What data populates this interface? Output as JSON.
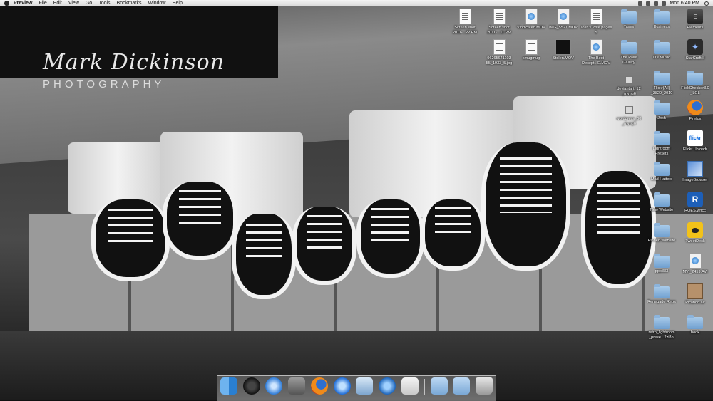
{
  "menubar": {
    "app_name": "Preview",
    "items": [
      "File",
      "Edit",
      "View",
      "Go",
      "Tools",
      "Bookmarks",
      "Window",
      "Help"
    ],
    "clock": "Mon 6:40 PM"
  },
  "wallpaper": {
    "watermark_name": "Mark Dickinson",
    "watermark_sub": "PHOTOGRAPHY"
  },
  "desktop_icons": [
    {
      "label": "Screen shot\n2011-...22 PM",
      "icon": "document-icon"
    },
    {
      "label": "Screen shot\n2011-...11 PM",
      "icon": "document-icon"
    },
    {
      "label": "Vindicated.MOV",
      "icon": "movie-icon"
    },
    {
      "label": "IMG_5527.MOV",
      "icon": "movie-icon"
    },
    {
      "label": "Josh's Wife.pages\n5",
      "icon": "document-icon"
    },
    {
      "label": "Taxes",
      "icon": "folder-icon"
    },
    {
      "label": "Business",
      "icon": "folder-icon"
    },
    {
      "label": "Elements",
      "icon": "elements-icon"
    },
    {
      "label": "96265641103\n55_1933_5.jpg",
      "icon": "document-icon"
    },
    {
      "label": "smugmug",
      "icon": "document-icon"
    },
    {
      "label": "Stolen.MOV",
      "icon": "dark-icon"
    },
    {
      "label": "The Best\nDecept...E.MOV",
      "icon": "movie-icon"
    },
    {
      "label": "The Paint\nGallery",
      "icon": "folder-icon"
    },
    {
      "label": "D's Music",
      "icon": "folder-icon"
    },
    {
      "label": "StarCraft II",
      "icon": "starcraft-icon"
    },
    {
      "label": "deviantart_12\n_myng6",
      "icon": "small-file-icon"
    },
    {
      "label": "Flickr(All)\n_3829_2010",
      "icon": "folder-icon"
    },
    {
      "label": "FlickChecker3.0\n_LGL",
      "icon": "folder-icon"
    },
    {
      "label": "wordpress_60\n_myng6",
      "icon": "small-file-icon"
    },
    {
      "label": "Josh",
      "icon": "folder-icon"
    },
    {
      "label": "Firefox",
      "icon": "firefox-icon"
    },
    {
      "label": "Lightroom\nPresets",
      "icon": "folder-icon"
    },
    {
      "label": "Flickr Uploadr",
      "icon": "flickr-icon"
    },
    {
      "label": "Mad Hatters",
      "icon": "folder-icon"
    },
    {
      "label": "ImageBrowser",
      "icon": "image-browser-icon"
    },
    {
      "label": "New Website",
      "icon": "folder-icon"
    },
    {
      "label": "ROES.whcc",
      "icon": "roes-icon"
    },
    {
      "label": "Pinned Website",
      "icon": "folder-icon"
    },
    {
      "label": "TweetDeck",
      "icon": "tweetdeck-icon"
    },
    {
      "label": "ppp883",
      "icon": "folder-icon"
    },
    {
      "label": "MVI_2459.AVI",
      "icon": "movie-icon"
    },
    {
      "label": "Renegade Reps",
      "icon": "folder-icon"
    },
    {
      "label": "Picaboo.air",
      "icon": "package-icon"
    },
    {
      "label": "retro_lightroom\n_prese...2zi3hi",
      "icon": "folder-icon"
    },
    {
      "label": "book",
      "icon": "folder-icon"
    }
  ],
  "dock_items": [
    {
      "name": "Finder",
      "icon": "finder-icon"
    },
    {
      "name": "Dashboard",
      "icon": "dashboard-icon"
    },
    {
      "name": "Safari",
      "icon": "safari-icon"
    },
    {
      "name": "System Preferences",
      "icon": "system-preferences-icon"
    },
    {
      "name": "Firefox",
      "icon": "firefox-icon"
    },
    {
      "name": "iTunes",
      "icon": "itunes-icon"
    },
    {
      "name": "iPhoto",
      "icon": "iphoto-icon"
    },
    {
      "name": "QuickTime",
      "icon": "quicktime-icon"
    },
    {
      "name": "Preview",
      "icon": "preview-icon"
    },
    {
      "name": "Applications",
      "icon": "applications-stack-icon"
    },
    {
      "name": "Documents",
      "icon": "documents-stack-icon"
    },
    {
      "name": "Trash",
      "icon": "trash-icon"
    }
  ]
}
